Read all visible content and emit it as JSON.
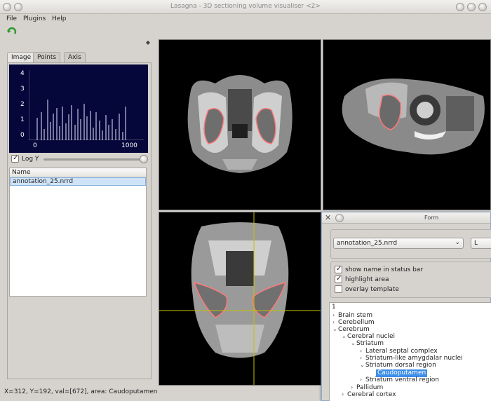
{
  "window": {
    "title": "Lasagna - 3D sectioning volume visualiser <2>"
  },
  "menubar": {
    "items": [
      {
        "label": "File"
      },
      {
        "label": "Plugins"
      },
      {
        "label": "Help"
      }
    ]
  },
  "toolbar": {
    "refresh_icon": "refresh-icon"
  },
  "left_panel": {
    "tabs": [
      {
        "label": "Image"
      },
      {
        "label": "Points"
      },
      {
        "label": "Axis"
      }
    ],
    "histogram": {
      "y_ticks": [
        "4",
        "3",
        "2",
        "1",
        "0"
      ],
      "x_ticks": [
        "0",
        "1000"
      ]
    },
    "log_y": {
      "label": "Log Y",
      "checked": true
    },
    "file_list": {
      "header": "Name",
      "rows": [
        {
          "name": "annotation_25.nrrd",
          "selected": true
        }
      ]
    }
  },
  "status_bar": {
    "text": "X=312, Y=192, val=[672], area: Caudoputamen"
  },
  "form": {
    "title": "Form",
    "file_select": {
      "value": "annotation_25.nrrd"
    },
    "second_button": {
      "label": "L"
    },
    "options": [
      {
        "label": "show name in status bar",
        "checked": true
      },
      {
        "label": "highlight area",
        "checked": true
      },
      {
        "label": "overlay template",
        "checked": false
      }
    ],
    "tree": {
      "root": "1",
      "items": [
        {
          "label": "Brain stem",
          "depth": 1,
          "expander": "›"
        },
        {
          "label": "Cerebellum",
          "depth": 1,
          "expander": "›"
        },
        {
          "label": "Cerebrum",
          "depth": 1,
          "expander": "⌄"
        },
        {
          "label": "Cerebral nuclei",
          "depth": 2,
          "expander": "⌄"
        },
        {
          "label": "Striatum",
          "depth": 3,
          "expander": "⌄"
        },
        {
          "label": "Lateral septal complex",
          "depth": 4,
          "expander": "›"
        },
        {
          "label": "Striatum-like amygdalar nuclei",
          "depth": 4,
          "expander": "›"
        },
        {
          "label": "Striatum dorsal region",
          "depth": 4,
          "expander": "⌄"
        },
        {
          "label": "Caudoputamen",
          "depth": 5,
          "expander": "",
          "selected": true
        },
        {
          "label": "Striatum ventral region",
          "depth": 4,
          "expander": "›"
        },
        {
          "label": "Pallidum",
          "depth": 3,
          "expander": "›"
        },
        {
          "label": "Cerebral cortex",
          "depth": 2,
          "expander": "›"
        }
      ]
    }
  },
  "colors": {
    "highlight_outline": "#ff7a7a",
    "crosshair": "#c8c000",
    "histogram_bg": "#05063a",
    "selection": "#3d8ee8"
  }
}
